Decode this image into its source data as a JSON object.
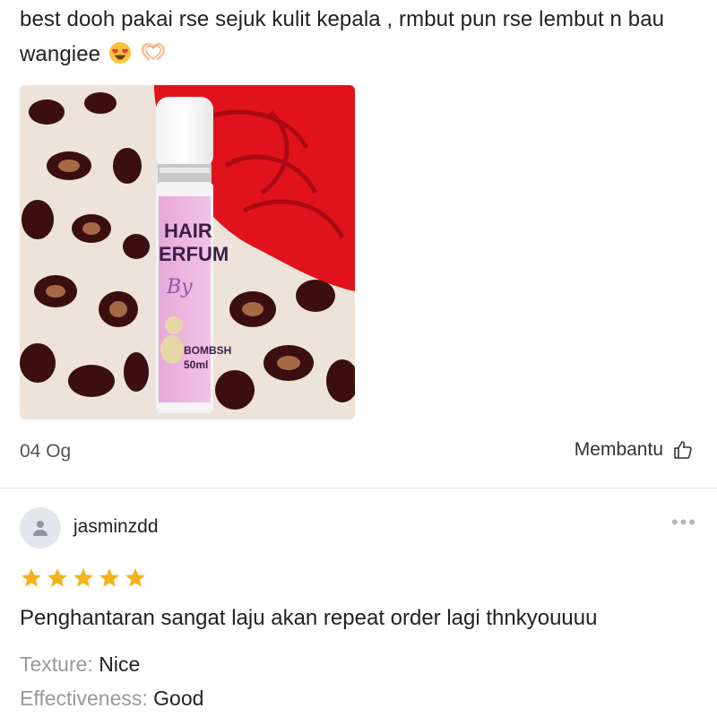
{
  "prev_review": {
    "text": "best dooh pakai rse sejuk kulit kepala , rmbut pun rse lembut n bau wangiee",
    "emojis": [
      "heart-eyes-emoji",
      "heart-hands-emoji"
    ],
    "photo": {
      "product_lines": [
        "HAIR",
        "ERFUM"
      ],
      "brand_script": "By",
      "variant": "BOMBSH",
      "volume": "50ml"
    },
    "date": "04 Og",
    "helpful_label": "Membantu"
  },
  "review": {
    "username": "jasminzdd",
    "rating": 5,
    "text": "Penghantaran sangat laju akan repeat order lagi thnkyouuuu",
    "attributes": [
      {
        "key": "Texture:",
        "value": "Nice"
      },
      {
        "key": "Effectiveness:",
        "value": "Good"
      }
    ]
  },
  "colors": {
    "star": "#F5B21B",
    "divider": "#E6E6E6",
    "avatar_bg": "#E3E7EC"
  }
}
